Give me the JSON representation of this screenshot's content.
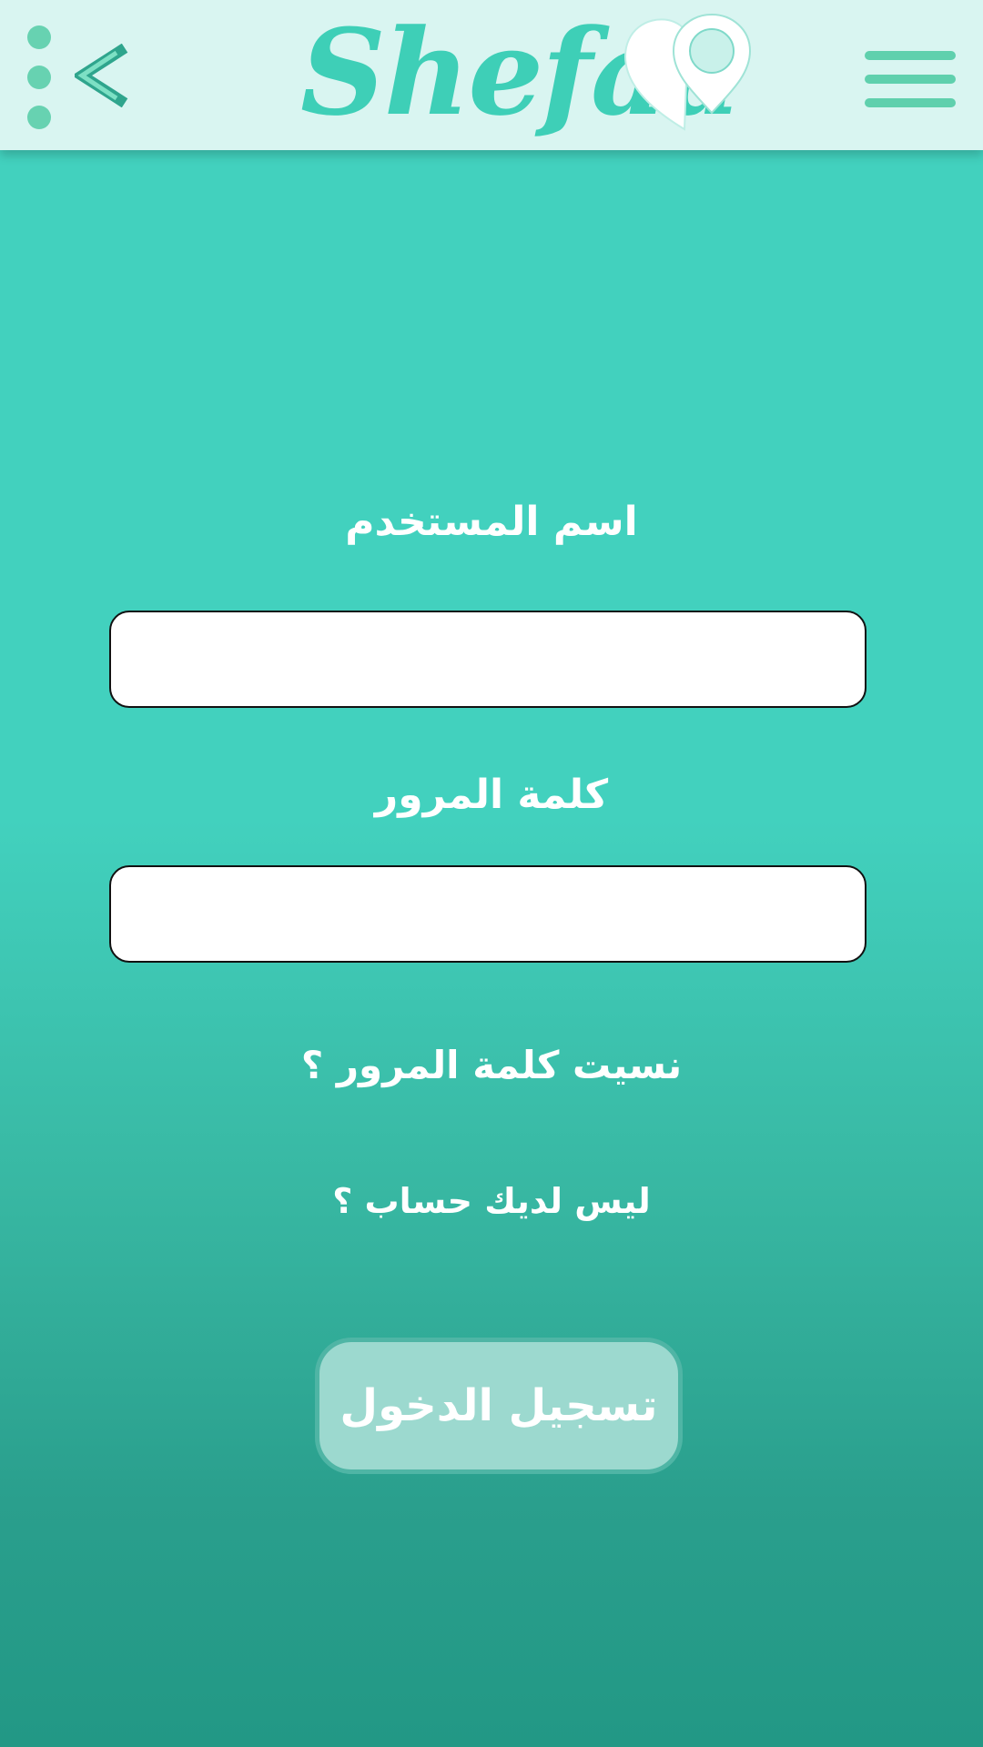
{
  "header": {
    "brand": "Shefaa",
    "back_label": "<",
    "icons": {
      "menu": "kebab-menu-icon",
      "back": "back-chevron-icon",
      "logo": "map-pin-heart-logo",
      "nav": "hamburger-menu-icon"
    }
  },
  "form": {
    "username_label": "اسم المستخدم",
    "username_value": "",
    "password_label": "كلمة المرور",
    "password_value": "",
    "forgot_password": "نسيت كلمة المرور ؟",
    "no_account": "ليس لديك حساب ؟",
    "login_button": "تسجيل الدخول"
  },
  "colors": {
    "header_bg": "#d9f5f1",
    "brand": "#3ecfb7",
    "background_top": "#42d1be",
    "background_bottom": "#229885",
    "button_bg": "#9cd9cf",
    "button_border": "#4fb5a5"
  }
}
